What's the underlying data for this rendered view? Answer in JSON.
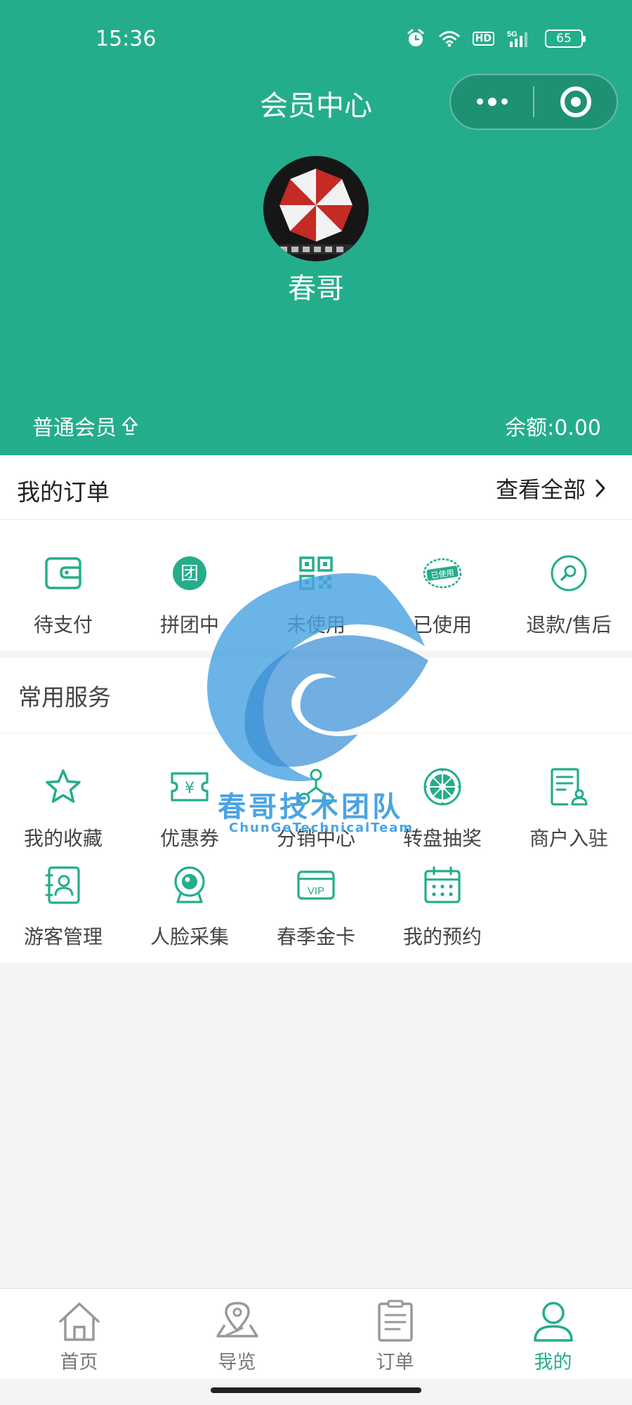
{
  "status_bar": {
    "time": "15:36",
    "icons": [
      "alarm-icon",
      "wifi-icon",
      "hd-icon",
      "5g-signal-icon",
      "battery-icon"
    ],
    "hd_label": "HD",
    "network_label": "5G",
    "battery": "65"
  },
  "header": {
    "title": "会员中心",
    "username": "春哥",
    "member_level": "普通会员",
    "balance": "余额:0.00",
    "background_color": "#24ad8c"
  },
  "orders": {
    "title": "我的订单",
    "view_all": "查看全部",
    "items": [
      {
        "label": "待支付",
        "icon": "wallet-icon"
      },
      {
        "label": "拼团中",
        "icon": "group-icon",
        "glyph": "团"
      },
      {
        "label": "未使用",
        "icon": "qrcode-icon"
      },
      {
        "label": "已使用",
        "icon": "used-stamp-icon",
        "glyph": "已使用"
      },
      {
        "label": "退款/售后",
        "icon": "refund-search-icon"
      }
    ]
  },
  "services": {
    "title": "常用服务",
    "rows": [
      [
        {
          "label": "我的收藏",
          "icon": "star-icon"
        },
        {
          "label": "优惠券",
          "icon": "coupon-icon",
          "glyph": "¥"
        },
        {
          "label": "分销中心",
          "icon": "distribution-icon"
        },
        {
          "label": "转盘抽奖",
          "icon": "lottery-wheel-icon"
        },
        {
          "label": "商户入驻",
          "icon": "merchant-apply-icon"
        }
      ],
      [
        {
          "label": "游客管理",
          "icon": "visitor-book-icon"
        },
        {
          "label": "人脸采集",
          "icon": "face-camera-icon"
        },
        {
          "label": "春季金卡",
          "icon": "vip-card-icon",
          "glyph": "VIP"
        },
        {
          "label": "我的预约",
          "icon": "calendar-icon"
        }
      ]
    ]
  },
  "watermark": {
    "text": "春哥技术团队",
    "subtext": "ChunGeTechnicalTeam"
  },
  "tabbar": {
    "items": [
      {
        "label": "首页",
        "icon": "home-icon",
        "active": false
      },
      {
        "label": "导览",
        "icon": "map-pin-icon",
        "active": false
      },
      {
        "label": "订单",
        "icon": "order-list-icon",
        "active": false
      },
      {
        "label": "我的",
        "icon": "user-icon",
        "active": true
      }
    ]
  },
  "colors": {
    "accent": "#24ad8c",
    "tab_inactive": "#777777",
    "watermark_blue": "#4aa4e2"
  }
}
